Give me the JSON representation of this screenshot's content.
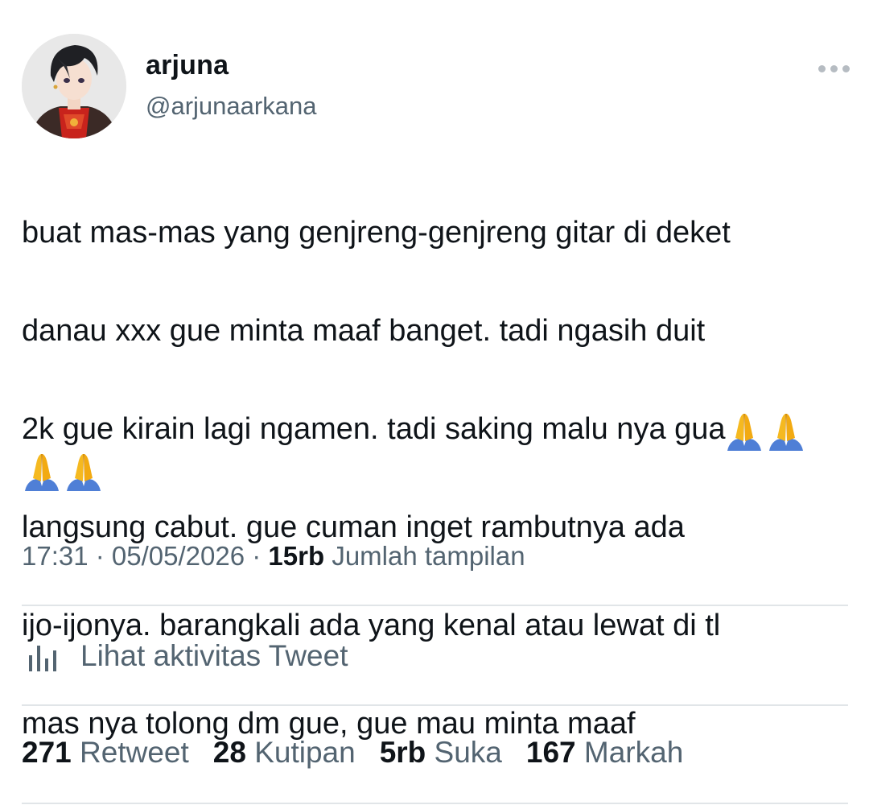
{
  "user": {
    "display_name": "arjuna",
    "handle": "@arjunaarkana"
  },
  "tweet": {
    "lines": [
      "buat mas-mas yang genjreng-genjreng gitar di deket",
      "danau xxx gue minta maaf banget. tadi ngasih duit",
      "2k gue kirain lagi ngamen. tadi saking malu nya gua",
      "langsung cabut. gue cuman inget rambutnya ada",
      "ijo-ijonya. barangkali ada yang kenal atau lewat di tl",
      "mas nya tolong dm gue, gue mau minta maaf"
    ],
    "emoji": [
      "🙏",
      "🙏",
      "🙏",
      "🙏"
    ]
  },
  "meta": {
    "time": "17:31",
    "separator": " · ",
    "date": "05/05/2026",
    "views_count": "15rb",
    "views_label": "Jumlah tampilan"
  },
  "activity": {
    "label": "Lihat aktivitas Tweet",
    "icon": "bar-chart-icon"
  },
  "stats": [
    {
      "count": "271",
      "label": "Retweet"
    },
    {
      "count": "28",
      "label": "Kutipan"
    },
    {
      "count": "5rb",
      "label": "Suka"
    },
    {
      "count": "167",
      "label": "Markah"
    }
  ],
  "colors": {
    "text_primary": "#0f1419",
    "text_secondary": "#536471",
    "divider": "#e1e5e8"
  }
}
